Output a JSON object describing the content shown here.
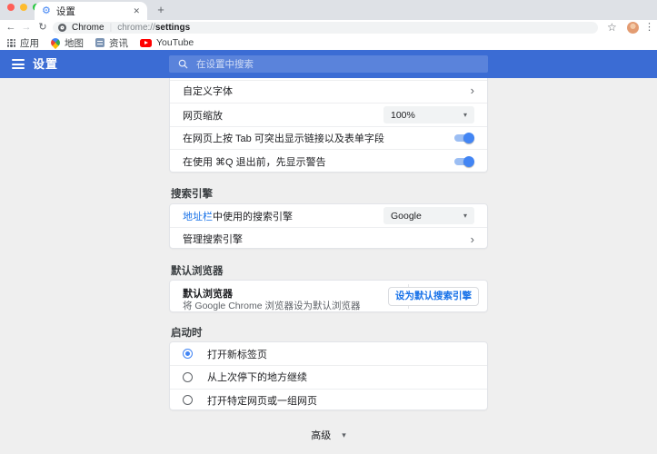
{
  "browser": {
    "tab_title": "设置",
    "omnibox": {
      "site": "Chrome",
      "separator": "|",
      "scheme": "chrome://",
      "path": "settings"
    },
    "bookmarks": {
      "apps": "应用",
      "maps": "地图",
      "news": "资讯",
      "youtube": "YouTube"
    }
  },
  "header": {
    "title": "设置",
    "search_placeholder": "在设置中搜索"
  },
  "appearance": {
    "customize_fonts": "自定义字体",
    "page_zoom_label": "网页缩放",
    "page_zoom_value": "100%",
    "tab_highlight_label": "在网页上按 Tab 可突出显示链接以及表单字段",
    "warn_quit_label": "在使用 ⌘Q 退出前，先显示警告"
  },
  "search_engine": {
    "section_title": "搜索引擎",
    "address_bar_link": "地址栏",
    "address_bar_rest": "中使用的搜索引擎",
    "engine_value": "Google",
    "manage_label": "管理搜索引擎"
  },
  "default_browser": {
    "section_title": "默认浏览器",
    "card_title": "默认浏览器",
    "card_subtitle": "将 Google Chrome 浏览器设为默认浏览器",
    "button_label": "设为默认搜索引擎"
  },
  "startup": {
    "section_title": "启动时",
    "options": [
      {
        "label": "打开新标签页",
        "selected": true
      },
      {
        "label": "从上次停下的地方继续",
        "selected": false
      },
      {
        "label": "打开特定网页或一组网页",
        "selected": false
      }
    ]
  },
  "footer": {
    "advanced_label": "高级"
  },
  "icons": {
    "back": "←",
    "forward": "→",
    "reload": "↻",
    "star": "☆",
    "menu": "⋮",
    "close": "✕",
    "new_tab": "+",
    "gear": "⚙",
    "arrow_right": "›",
    "caret_down": "▾"
  },
  "colors": {
    "header_blue": "#3b6cd4",
    "accent_blue": "#4285f4",
    "link_blue": "#1a73e8"
  }
}
